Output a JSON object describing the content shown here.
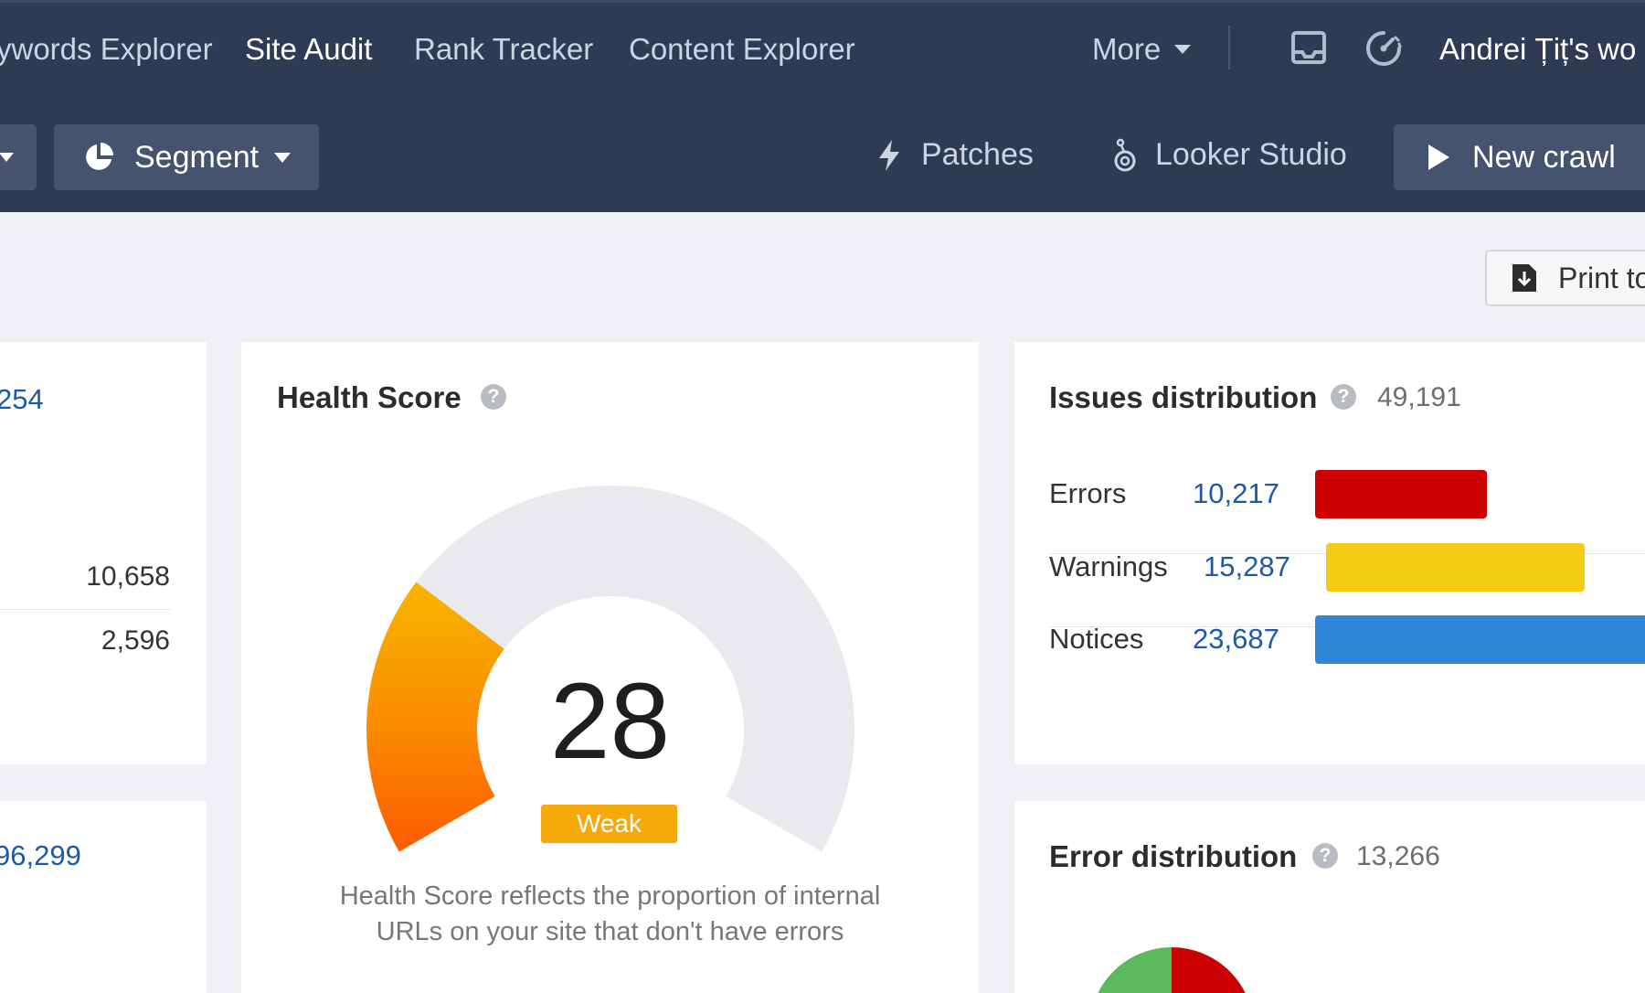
{
  "nav": {
    "items": [
      {
        "label": "ywords Explorer"
      },
      {
        "label": "Site Audit"
      },
      {
        "label": "Rank Tracker"
      },
      {
        "label": "Content Explorer"
      }
    ],
    "more_label": "More",
    "user_label": "Andrei Țiț's wo"
  },
  "toolbar": {
    "segment_label": "Segment",
    "patches_label": "Patches",
    "looker_label": "Looker Studio",
    "new_crawl_label": "New crawl"
  },
  "print_label": "Print to",
  "left_card": {
    "top_value": "254",
    "row1_value": "10,658",
    "row2_value": "2,596",
    "bottom_value": "96,299"
  },
  "health": {
    "title": "Health Score",
    "score": "28",
    "score_value": 28,
    "badge": "Weak",
    "description_line1": "Health Score reflects the proportion of internal",
    "description_line2": "URLs on your site that don't have errors"
  },
  "issues": {
    "title": "Issues distribution",
    "total": "49,191",
    "rows": [
      {
        "label": "Errors",
        "value": "10,217",
        "color": "#cc0000"
      },
      {
        "label": "Warnings",
        "value": "15,287",
        "color": "#f5cc14"
      },
      {
        "label": "Notices",
        "value": "23,687",
        "color": "#2f86d8"
      }
    ]
  },
  "error_dist": {
    "title": "Error distribution",
    "total": "13,266"
  },
  "colors": {
    "header_bg": "#2f3b55",
    "button_bg": "#46536f",
    "link_blue": "#1c5aa7",
    "badge_orange": "#f6a90c"
  }
}
